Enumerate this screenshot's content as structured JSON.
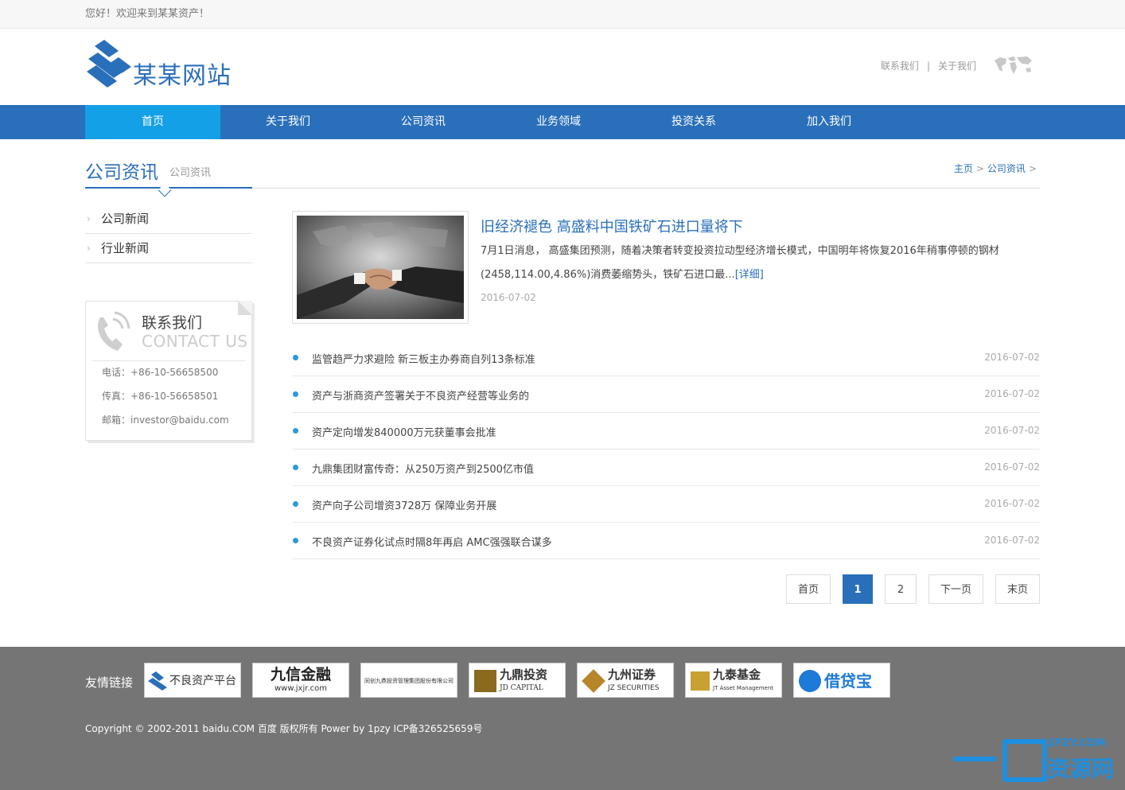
{
  "topbar": {
    "welcome": "您好！欢迎来到某某资产！"
  },
  "header": {
    "site_name": "某某网站",
    "links": [
      "联系我们",
      "关于我们"
    ],
    "separator": "|"
  },
  "nav": {
    "items": [
      {
        "label": "首页",
        "active": true
      },
      {
        "label": "关于我们"
      },
      {
        "label": "公司资讯"
      },
      {
        "label": "业务领域"
      },
      {
        "label": "投资关系"
      },
      {
        "label": "加入我们"
      }
    ]
  },
  "page": {
    "title": "公司资讯",
    "subtitle": "公司资讯",
    "breadcrumb": {
      "home": "主页",
      "sep1": ">",
      "current": "公司资讯",
      "sep2": ">"
    }
  },
  "sidebar": {
    "items": [
      {
        "label": "公司新闻"
      },
      {
        "label": "行业新闻"
      }
    ],
    "contact": {
      "title": "联系我们",
      "title_en": "CONTACT US",
      "phone": "电话：+86-10-56658500",
      "fax": "传真：+86-10-56658501",
      "email": "邮箱：investor@baidu.com"
    }
  },
  "featured": {
    "title": "旧经济褪色 高盛料中国铁矿石进口量将下",
    "desc": "7月1日消息， 高盛集团预测，随着决策者转变投资拉动型经济增长模式，中国明年将恢复2016年稍事停顿的钢材(2458,114.00,4.86%)消费萎缩势头，铁矿石进口最...",
    "more": "[详细]",
    "date": "2016-07-02"
  },
  "news": [
    {
      "title": "监管趋严力求避险 新三板主办券商自列13条标准",
      "date": "2016-07-02"
    },
    {
      "title": "资产与浙商资产签署关于不良资产经营等业务的",
      "date": "2016-07-02"
    },
    {
      "title": "资产定向增发840000万元获董事会批准",
      "date": "2016-07-02"
    },
    {
      "title": "九鼎集团财富传奇：从250万资产到2500亿市值",
      "date": "2016-07-02"
    },
    {
      "title": "资产向子公司增资3728万 保障业务开展",
      "date": "2016-07-02"
    },
    {
      "title": "不良资产证券化试点时隔8年再启 AMC强强联合谋多",
      "date": "2016-07-02"
    }
  ],
  "pager": {
    "first": "首页",
    "p1": "1",
    "p2": "2",
    "next": "下一页",
    "last": "末页"
  },
  "footer": {
    "links_label": "友情链接",
    "partners": [
      {
        "name": "不良资产平台"
      },
      {
        "name": "九信金融",
        "sub": "www.jxjr.com"
      },
      {
        "name": "同创九鼎投资管理集团股份有限公司"
      },
      {
        "name": "九鼎投资",
        "sub": "JD CAPITAL"
      },
      {
        "name": "九州证券",
        "sub": "JZ SECURITIES"
      },
      {
        "name": "九泰基金",
        "sub": "JT Asset Management"
      },
      {
        "name": "借贷宝"
      }
    ],
    "copyright": "Copyright © 2002-2011 baidu.COM 百度 版权所有 Power by 1pzy ICP备326525659号"
  },
  "watermark": {
    "text": "资源网",
    "sub": "1PZY.COM"
  },
  "colors": {
    "brand": "#2a6fba",
    "nav_active": "#13a0e6",
    "footer": "#757575"
  }
}
